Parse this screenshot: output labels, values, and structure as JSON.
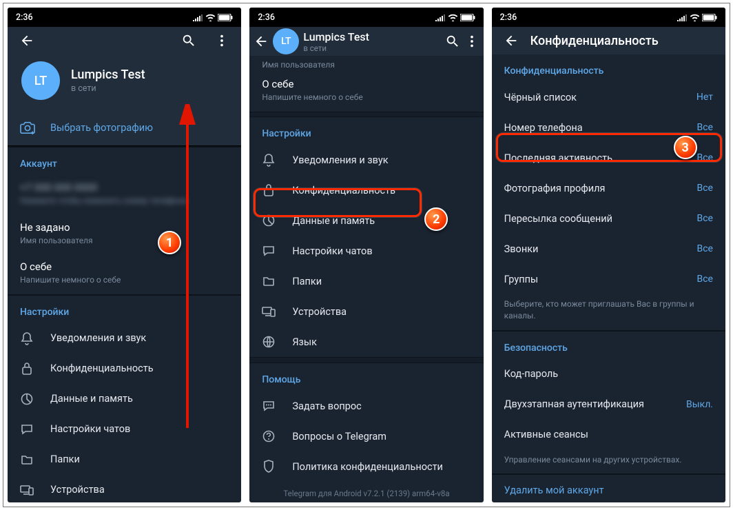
{
  "status": {
    "time": "2:36"
  },
  "badges": {
    "one": "1",
    "two": "2",
    "three": "3"
  },
  "screen1": {
    "avatar_initials": "LT",
    "profile_name": "Lumpics Test",
    "profile_status": "в сети",
    "choose_photo": "Выбрать фотографию",
    "section_account": "Аккаунт",
    "username_value": "Не задано",
    "username_label": "Имя пользователя",
    "bio_value": "О себе",
    "bio_hint": "Напишите немного о себе",
    "section_settings": "Настройки",
    "items": {
      "notifications": "Уведомления и звук",
      "privacy": "Конфиденциальность",
      "data": "Данные и память",
      "chats": "Настройки чатов",
      "folders": "Папки",
      "devices": "Устройства"
    }
  },
  "screen2": {
    "avatar_initials": "LT",
    "profile_name": "Lumpics Test",
    "profile_status": "в сети",
    "username_label": "Имя пользователя",
    "bio_value": "О себе",
    "bio_hint": "Напишите немного о себе",
    "section_settings": "Настройки",
    "items": {
      "notifications": "Уведомления и звук",
      "privacy": "Конфиденциальность",
      "data": "Данные и память",
      "chats": "Настройки чатов",
      "folders": "Папки",
      "devices": "Устройства",
      "language": "Язык"
    },
    "section_help": "Помощь",
    "help": {
      "ask": "Задать вопрос",
      "faq": "Вопросы о Telegram",
      "policy": "Политика конфиденциальности"
    },
    "version": "Telegram для Android v7.2.1 (2139) arm64-v8a"
  },
  "screen3": {
    "title": "Конфиденциальность",
    "section_privacy": "Конфиденциальность",
    "rows": {
      "blocked": {
        "label": "Чёрный список",
        "value": "Нет"
      },
      "phone": {
        "label": "Номер телефона",
        "value": "Все"
      },
      "lastseen": {
        "label": "Последняя активность",
        "value": "Все"
      },
      "photo": {
        "label": "Фотография профиля",
        "value": "Все"
      },
      "forward": {
        "label": "Пересылка сообщений",
        "value": "Все"
      },
      "calls": {
        "label": "Звонки",
        "value": "Все"
      },
      "groups": {
        "label": "Группы",
        "value": "Все"
      }
    },
    "groups_hint": "Выберите, кто может приглашать Вас в группы и каналы.",
    "section_security": "Безопасность",
    "security": {
      "passcode": "Код-пароль",
      "twostep": {
        "label": "Двухэтапная аутентификация",
        "value": "Выкл."
      },
      "sessions": "Активные сеансы"
    },
    "sessions_hint": "Управление сеансами на других устройствах.",
    "delete_account": "Удалить мой аккаунт"
  }
}
